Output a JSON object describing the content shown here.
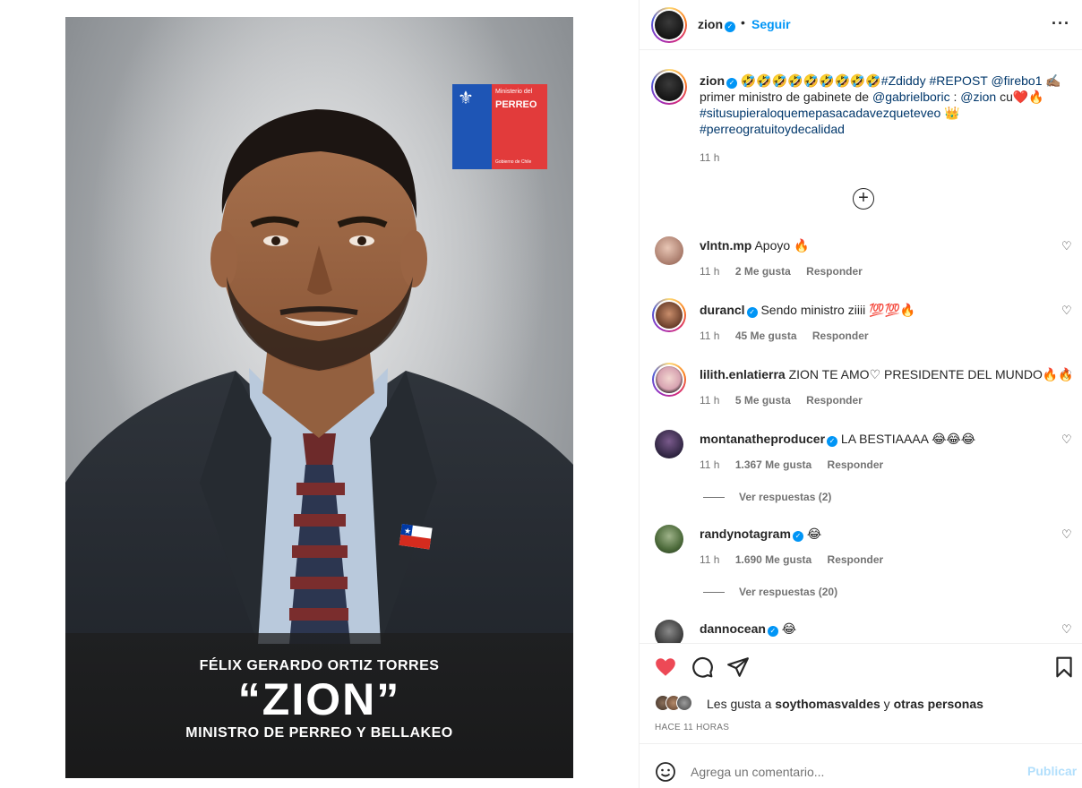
{
  "post_image": {
    "logo": {
      "line1": "Ministerio del",
      "line2": "PERREO",
      "line3": "Gobierno de Chile"
    },
    "caption_name": "FÉLIX GERARDO ORTIZ TORRES",
    "caption_alias": "“ZION”",
    "caption_role": "MINISTRO DE PERREO Y BELLAKEO"
  },
  "header": {
    "username": "zion",
    "separator": "•",
    "follow_label": "Seguir",
    "more_icon": "more-horizontal-icon"
  },
  "caption": {
    "username": "zion",
    "emojis": "🤣🤣🤣🤣🤣🤣🤣🤣🤣",
    "tags1": "#Zdiddy #REPOST @firebo1",
    "emoji_write": "✍🏽",
    "text2": "primer ministro de gabinete de",
    "mention2": "@gabrielboric",
    "text3": ":",
    "mention3": "@zion",
    "text4": "cu",
    "emoji4": "❤️🔥",
    "tag5": "#situsupieraloquemepasacadavezqueteveo",
    "emoji5": "👑",
    "tag6": "#perreogratuitoydecalidad",
    "time": "11 h"
  },
  "comments": [
    {
      "username": "vlntn.mp",
      "verified": false,
      "text": "Apoyo 🔥",
      "time": "11 h",
      "likes": "2 Me gusta",
      "reply": "Responder"
    },
    {
      "username": "durancl",
      "verified": true,
      "text": "Sendo ministro ziiii 💯💯🔥",
      "time": "11 h",
      "likes": "45 Me gusta",
      "reply": "Responder"
    },
    {
      "username": "lilith.enlatierra",
      "verified": false,
      "text": "ZION TE AMO♡ PRESIDENTE DEL MUNDO🔥🔥",
      "time": "11 h",
      "likes": "5 Me gusta",
      "reply": "Responder"
    },
    {
      "username": "montanatheproducer",
      "verified": true,
      "text": "LA BESTIAAAA 😂😂😂",
      "time": "11 h",
      "likes": "1.367 Me gusta",
      "reply": "Responder",
      "replies": "Ver respuestas (2)"
    },
    {
      "username": "randynotagram",
      "verified": true,
      "text": "😂",
      "time": "11 h",
      "likes": "1.690 Me gusta",
      "reply": "Responder",
      "replies": "Ver respuestas (20)"
    },
    {
      "username": "dannocean",
      "verified": true,
      "text": "😂"
    }
  ],
  "actions": {
    "liked": true,
    "like_color": "#ed4956",
    "likes_prefix": "Les gusta a",
    "likes_user": "soythomasvaldes",
    "likes_middle": "y",
    "likes_suffix": "otras personas",
    "post_time": "HACE 11 HORAS"
  },
  "add_comment": {
    "placeholder": "Agrega un comentario...",
    "publish_label": "Publicar"
  },
  "colors": {
    "accent": "#0095f6",
    "text": "#262626",
    "muted": "#737373",
    "link": "#00376b"
  }
}
